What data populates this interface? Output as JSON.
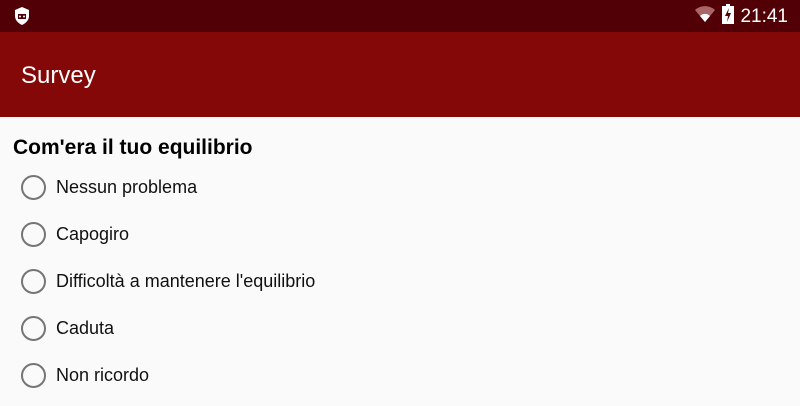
{
  "status_bar": {
    "time": "21:41",
    "icons": [
      "shield-app-icon",
      "wifi-icon",
      "battery-charging-icon"
    ]
  },
  "app_bar": {
    "title": "Survey"
  },
  "question": "Com'era il tuo equilibrio",
  "options": [
    "Nessun problema",
    "Capogiro",
    "Difficoltà a mantenere l'equilibrio",
    "Caduta",
    "Non ricordo"
  ],
  "colors": {
    "status_bar": "#510005",
    "app_bar": "#850809"
  }
}
